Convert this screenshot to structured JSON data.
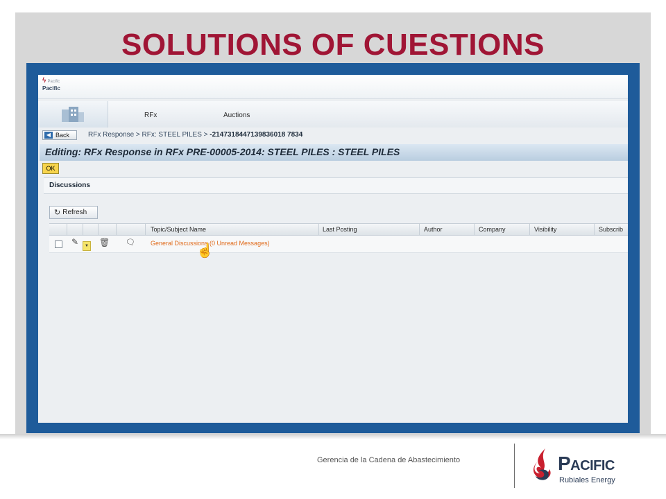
{
  "slide": {
    "title": "SOLUTIONS OF CUESTIONS",
    "footer_text": "Gerencia de la Cadena de Abastecimiento",
    "logo": {
      "word": "Pacific",
      "sub": "Rubiales Energy",
      "icon": "pacific-flame-logo"
    }
  },
  "app": {
    "mini_logo": {
      "top": "Pacific",
      "brand": "Pacific"
    },
    "nav": {
      "rfx": "RFx",
      "auctions": "Auctions"
    },
    "breadcrumb": {
      "back_label": "Back",
      "path": "RFx Response  >  RFx: STEEL PILES  >",
      "id": "-2147318447139836018 7834"
    },
    "editing_title": "Editing: RFx Response in RFx PRE-00005-2014: STEEL PILES : STEEL PILES",
    "ok_label": "OK",
    "section_label": "Discussions",
    "refresh_label": "Refresh",
    "table": {
      "headers": [
        "Topic/Subject Name",
        "Last Posting",
        "Author",
        "Company",
        "Visibility",
        "Subscrib"
      ],
      "rows": [
        {
          "topic": "General Discussions (0 Unread Messages)"
        }
      ]
    }
  },
  "colors": {
    "title": "#a01535",
    "frame": "#1e5b9a",
    "link": "#e06a1a",
    "ok_button": "#f7d44c"
  }
}
